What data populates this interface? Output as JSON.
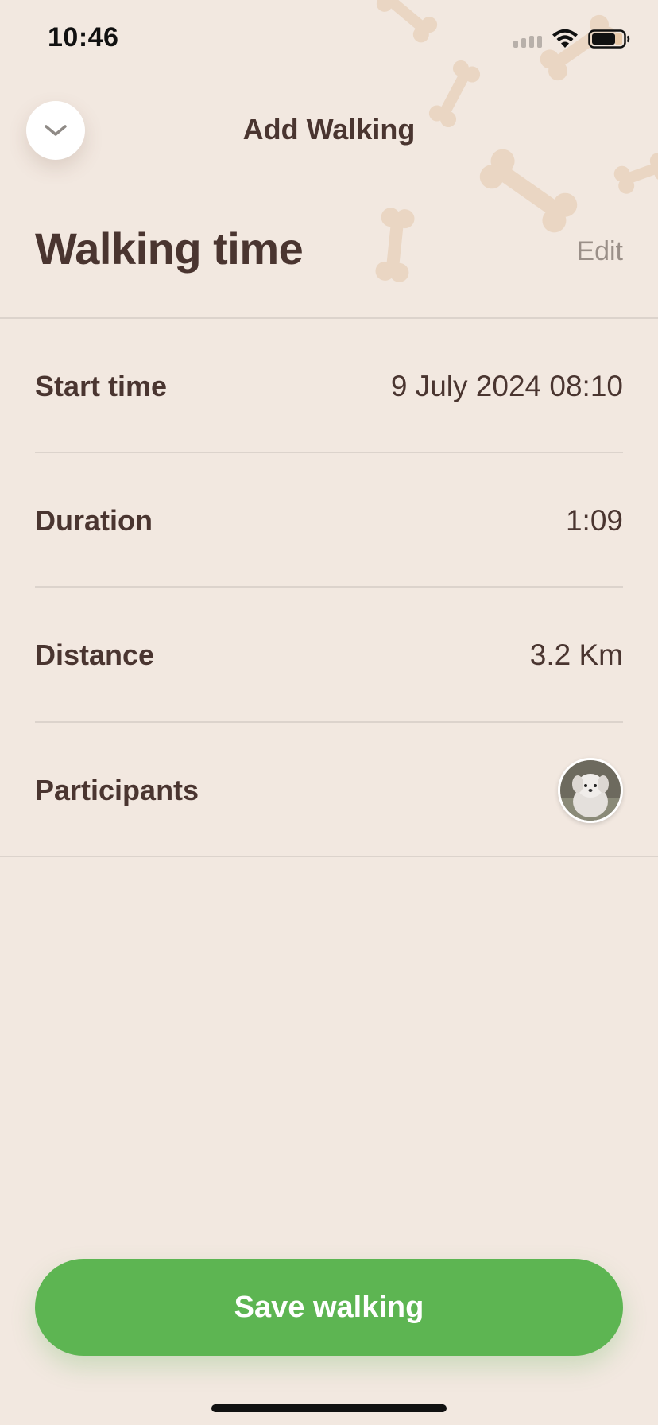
{
  "status_bar": {
    "time": "10:46"
  },
  "header": {
    "title": "Add Walking",
    "back_icon": "chevron-down-icon"
  },
  "section": {
    "title": "Walking time",
    "edit_label": "Edit"
  },
  "rows": [
    {
      "label": "Start time",
      "value": "9 July 2024 08:10"
    },
    {
      "label": "Duration",
      "value": "1:09"
    },
    {
      "label": "Distance",
      "value": "3.2 Km"
    },
    {
      "label": "Participants",
      "avatar_icon": "dog-avatar-icon"
    }
  ],
  "footer": {
    "save_label": "Save walking"
  },
  "colors": {
    "background": "#f2e8e0",
    "text": "#4a3530",
    "accent": "#5db552",
    "muted": "#9a8f88",
    "bone": "#e9d4c1"
  }
}
